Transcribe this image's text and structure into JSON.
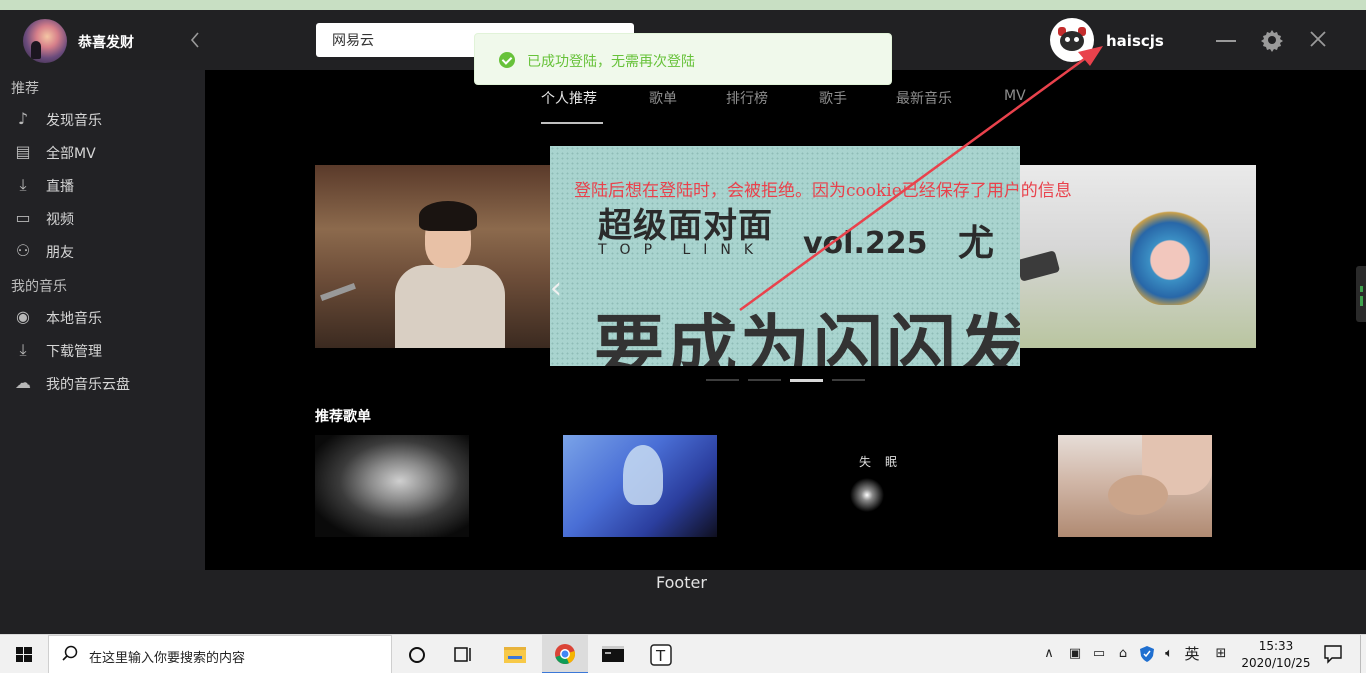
{
  "header": {
    "app_name": "恭喜发财",
    "search_value": "网易云",
    "username": "haiscjs"
  },
  "sidebar": {
    "sections": [
      {
        "title": "推荐",
        "items": [
          {
            "label": "发现音乐",
            "icon": "music-note-icon"
          },
          {
            "label": "全部MV",
            "icon": "mv-icon"
          },
          {
            "label": "直播",
            "icon": "download-icon"
          },
          {
            "label": "视频",
            "icon": "video-icon"
          },
          {
            "label": "朋友",
            "icon": "friends-icon"
          }
        ]
      },
      {
        "title": "我的音乐",
        "items": [
          {
            "label": "本地音乐",
            "icon": "disc-icon"
          },
          {
            "label": "下载管理",
            "icon": "download-icon"
          },
          {
            "label": "我的音乐云盘",
            "icon": "cloud-icon"
          }
        ]
      }
    ]
  },
  "tabs": [
    "个人推荐",
    "歌单",
    "排行榜",
    "歌手",
    "最新音乐",
    "MV"
  ],
  "active_tab": "个人推荐",
  "banner": {
    "title": "超级面对面",
    "subtitle": "TOP LINK",
    "vol": "vol.225",
    "name_fragment": "尤",
    "big_text": "要成为闪闪发",
    "slide_count": 4,
    "active_slide": 3
  },
  "recommend": {
    "title": "推荐歌单",
    "card3_text": "失眠"
  },
  "footer": {
    "text": "Footer"
  },
  "toast": {
    "message": "已成功登陆，无需再次登陆"
  },
  "annotation": "登陆后想在登陆时，会被拒绝。因为cookie已经保存了用户的信息",
  "taskbar": {
    "search_placeholder": "在这里输入你要搜索的内容",
    "ime": "英",
    "time": "15:33",
    "date": "2020/10/25"
  },
  "colors": {
    "accent_red": "#e9424c",
    "toast_green": "#67c23a",
    "toast_bg": "#f0f9eb",
    "sidebar_bg": "#222225",
    "main_bg": "#000000"
  }
}
